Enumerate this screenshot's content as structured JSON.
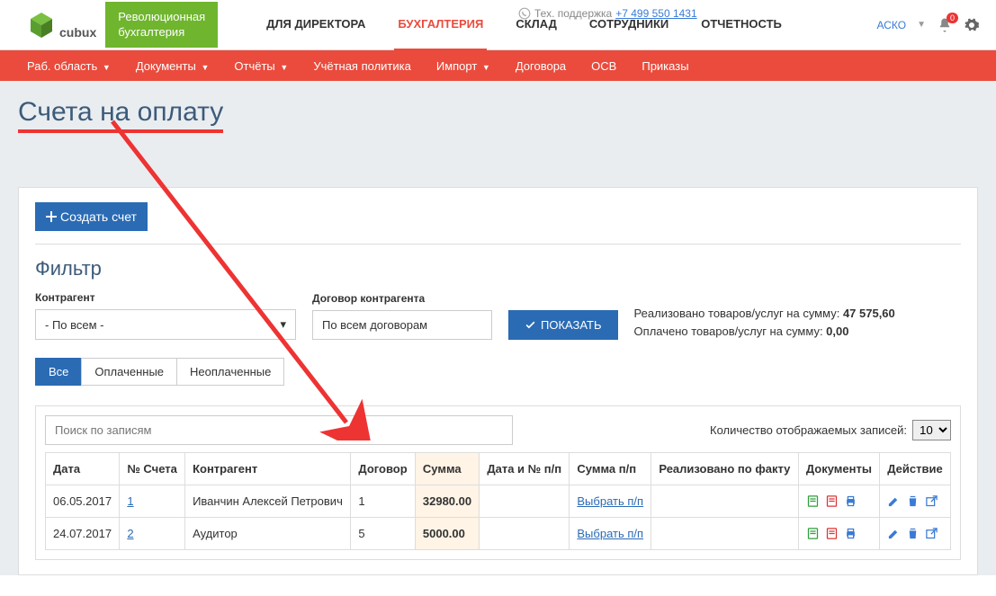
{
  "support": {
    "label": "Тех. поддержка",
    "phone": "+7 499 550 1431"
  },
  "brand": {
    "name": "cubux",
    "tagline1": "Революционная",
    "tagline2": "бухгалтерия"
  },
  "account": {
    "name": "АСКО",
    "notifications": "0"
  },
  "mainNav": [
    "ДЛЯ ДИРЕКТОРА",
    "БУХГАЛТЕРИЯ",
    "СКЛАД",
    "СОТРУДНИКИ",
    "ОТЧЕТНОСТЬ"
  ],
  "mainNavActive": 1,
  "redNav": [
    {
      "label": "Раб. область",
      "caret": true
    },
    {
      "label": "Документы",
      "caret": true
    },
    {
      "label": "Отчёты",
      "caret": true
    },
    {
      "label": "Учётная политика",
      "caret": false
    },
    {
      "label": "Импорт",
      "caret": true
    },
    {
      "label": "Договора",
      "caret": false
    },
    {
      "label": "ОСВ",
      "caret": false
    },
    {
      "label": "Приказы",
      "caret": false
    }
  ],
  "page": {
    "title": "Счета на оплату",
    "createBtn": "Создать счет",
    "filterTitle": "Фильтр",
    "counterpartyLabel": "Контрагент",
    "counterpartyValue": "- По всем -",
    "contractLabel": "Договор контрагента",
    "contractValue": "По всем договорам",
    "showBtn": "ПОКАЗАТЬ",
    "summary1a": "Реализовано товаров/услуг на сумму: ",
    "summary1b": "47 575,60",
    "summary2a": "Оплачено товаров/услуг на сумму: ",
    "summary2b": "0,00",
    "tabs": [
      "Все",
      "Оплаченные",
      "Неоплаченные"
    ],
    "tabActive": 0,
    "searchPlaceholder": "Поиск по записям",
    "pageSizeLabel": "Количество отображаемых записей:",
    "pageSize": "10",
    "columns": [
      "Дата",
      "№ Счета",
      "Контрагент",
      "Договор",
      "Сумма",
      "Дата и № п/п",
      "Сумма п/п",
      "Реализовано по факту",
      "Документы",
      "Действие"
    ],
    "selectPP": "Выбрать п/п",
    "rows": [
      {
        "date": "06.05.2017",
        "num": "1",
        "cp": "Иванчин Алексей Петрович",
        "contract": "1",
        "sum": "32980.00",
        "ppdate": "",
        "ppsum": ""
      },
      {
        "date": "24.07.2017",
        "num": "2",
        "cp": "Аудитор",
        "contract": "5",
        "sum": "5000.00",
        "ppdate": "",
        "ppsum": ""
      }
    ]
  }
}
